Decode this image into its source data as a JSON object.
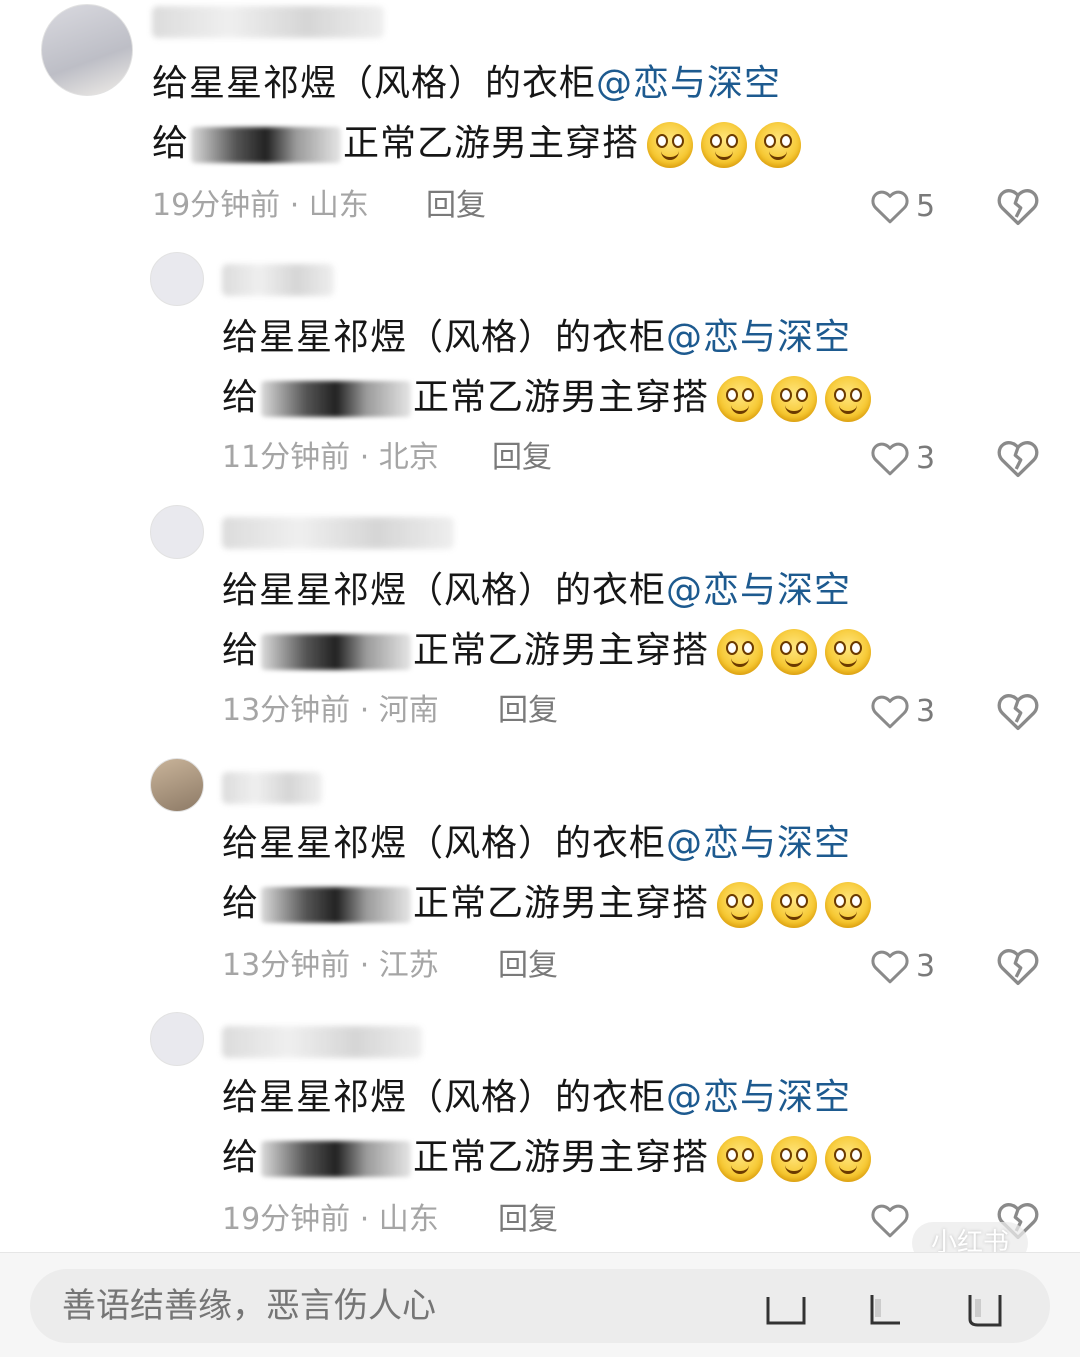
{
  "comments": [
    {
      "line1_text": "给星星祁煜（风格）的衣柜",
      "mention": "@恋与深空",
      "line2_prefix": "给",
      "line2_suffix": "正常乙游男主穿搭",
      "time": "19分钟前",
      "location": "山东",
      "reply_label": "回复",
      "likes": "5"
    },
    {
      "line1_text": "给星星祁煜（风格）的衣柜",
      "mention": "@恋与深空",
      "line2_prefix": "给",
      "line2_suffix": "正常乙游男主穿搭",
      "time": "11分钟前",
      "location": "北京",
      "reply_label": "回复",
      "likes": "3"
    },
    {
      "line1_text": "给星星祁煜（风格）的衣柜",
      "mention": "@恋与深空",
      "line2_prefix": "给",
      "line2_suffix": "正常乙游男主穿搭",
      "time": "13分钟前",
      "location": "河南",
      "reply_label": "回复",
      "likes": "3"
    },
    {
      "line1_text": "给星星祁煜（风格）的衣柜",
      "mention": "@恋与深空",
      "line2_prefix": "给",
      "line2_suffix": "正常乙游男主穿搭",
      "time": "13分钟前",
      "location": "江苏",
      "reply_label": "回复",
      "likes": "3"
    },
    {
      "line1_text": "给星星祁煜（风格）的衣柜",
      "mention": "@恋与深空",
      "line2_prefix": "给",
      "line2_suffix": "正常乙游男主穿搭",
      "time": "19分钟前",
      "location": "山东",
      "reply_label": "回复",
      "likes": ""
    }
  ],
  "sep": " · ",
  "watermark": "小红书",
  "input": {
    "placeholder": "善语结善缘，恶言伤人心"
  },
  "colors": {
    "mention": "#1d5a8f",
    "meta": "#a5a5a5",
    "text": "#161616"
  },
  "icons": [
    "heart-outline-icon",
    "broken-heart-icon",
    "smiley-emoji-icon",
    "edit-icon",
    "heart-icon",
    "star-icon"
  ]
}
